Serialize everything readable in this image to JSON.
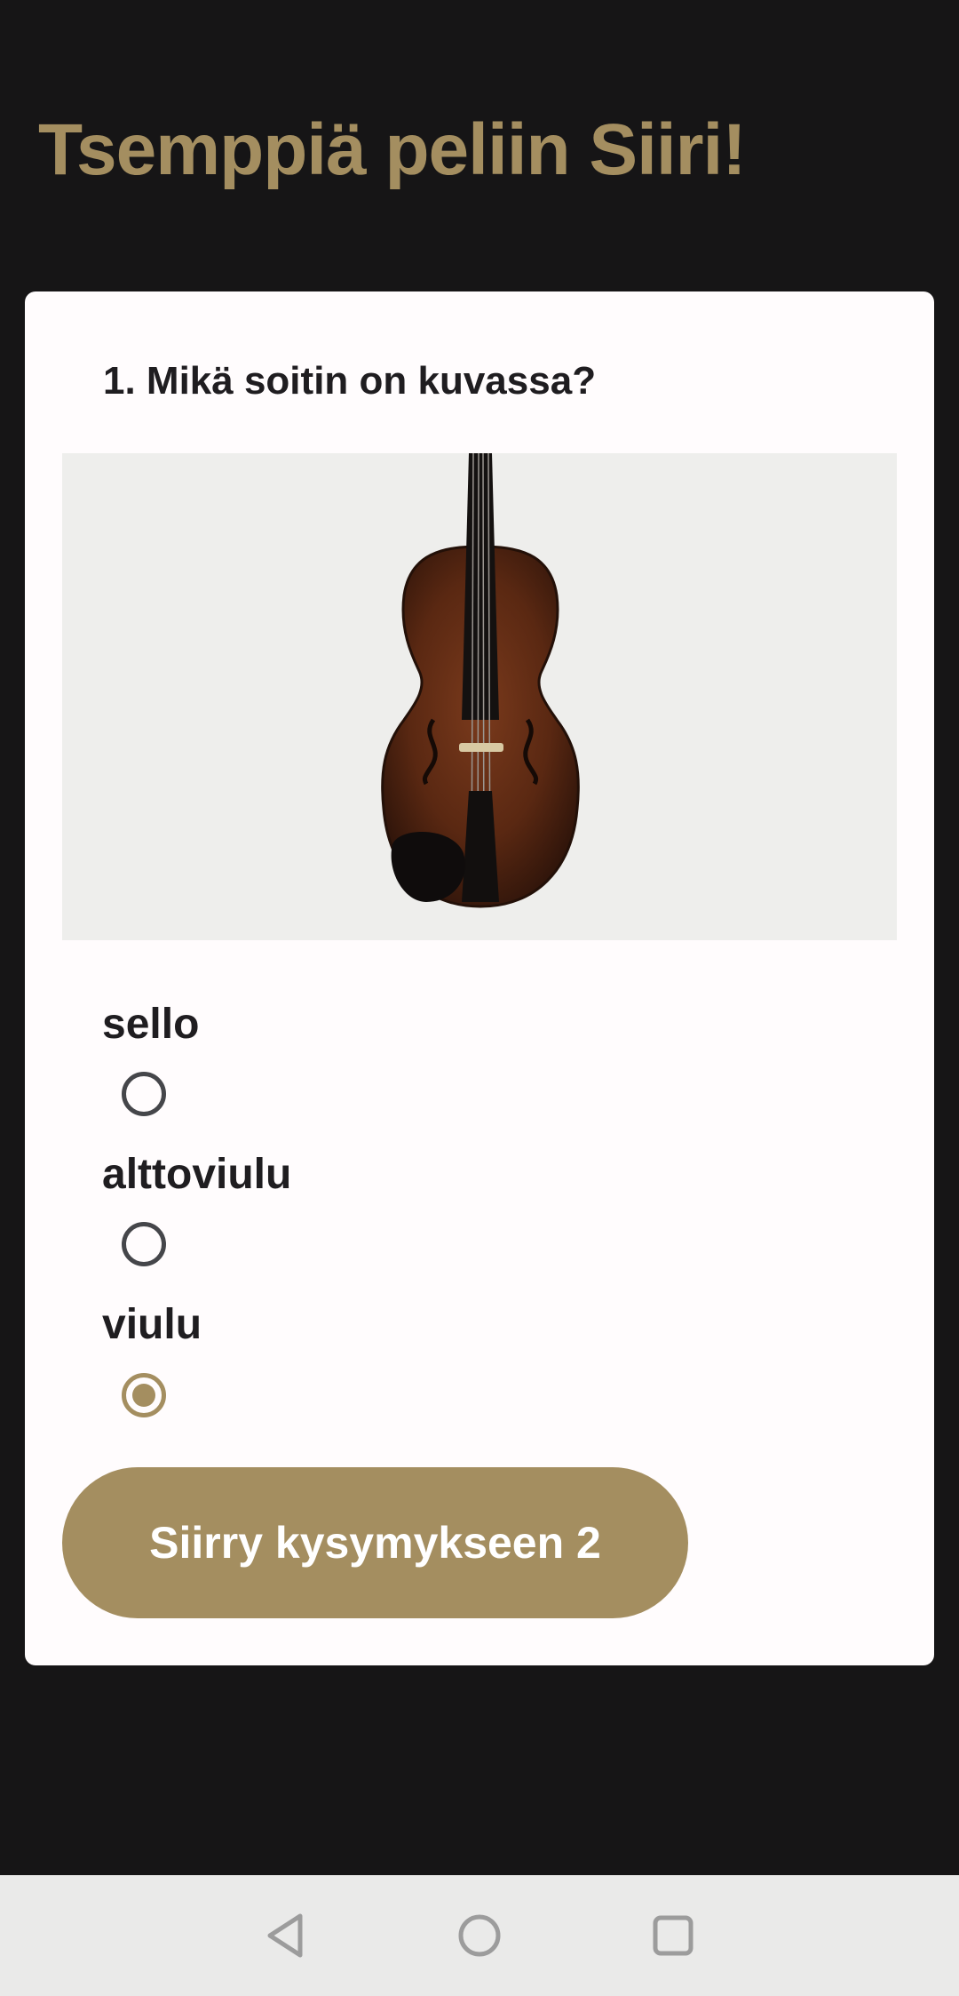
{
  "header": {
    "title": "Tsemppiä peliin Siiri!"
  },
  "quiz": {
    "question": "1. Mikä soitin on kuvassa?",
    "image_icon": "violin-photo",
    "options": [
      {
        "label": "sello",
        "selected": false
      },
      {
        "label": "alttoviulu",
        "selected": false
      },
      {
        "label": "viulu",
        "selected": true
      }
    ],
    "next_button_label": "Siirry kysymykseen 2"
  },
  "nav": {
    "back_icon": "back-triangle-icon",
    "home_icon": "home-circle-icon",
    "recents_icon": "recents-square-icon"
  },
  "colors": {
    "background": "#161516",
    "accent": "#a48e60",
    "card": "#fffcfd",
    "text": "#1f1d20"
  }
}
